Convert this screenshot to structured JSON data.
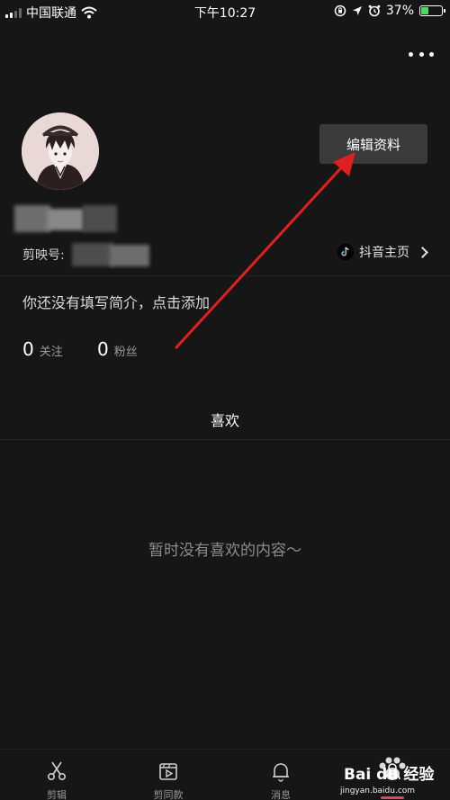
{
  "status_bar": {
    "carrier": "中国联通",
    "time": "下午10:27",
    "battery_percent": "37%",
    "battery_level": 0.37,
    "icons": [
      "signal-icon",
      "wifi-icon",
      "rotation-lock-icon",
      "location-icon",
      "alarm-icon",
      "battery-icon"
    ]
  },
  "profile": {
    "edit_button_label": "编辑资料",
    "id_label": "剪映号:",
    "douyin_link_label": "抖音主页",
    "bio_prompt": "你还没有填写简介，点击添加",
    "stats": [
      {
        "value": "0",
        "label": "关注"
      },
      {
        "value": "0",
        "label": "粉丝"
      }
    ]
  },
  "tabs": {
    "likes": "喜欢"
  },
  "empty_state": "暂时没有喜欢的内容～",
  "bottom_nav": [
    {
      "label": "剪辑",
      "icon": "scissors-icon"
    },
    {
      "label": "剪同款",
      "icon": "template-play-icon"
    },
    {
      "label": "消息",
      "icon": "bell-icon"
    },
    {
      "label": "",
      "icon": "profile-icon",
      "active": true
    }
  ],
  "watermark": {
    "text": "Bai du 经验",
    "url": "jingyan.baidu.com"
  },
  "colors": {
    "background": "#161616",
    "accent": "#f23e5c",
    "annotation_arrow": "#e02020",
    "edit_button_bg": "#3a3a3a"
  }
}
